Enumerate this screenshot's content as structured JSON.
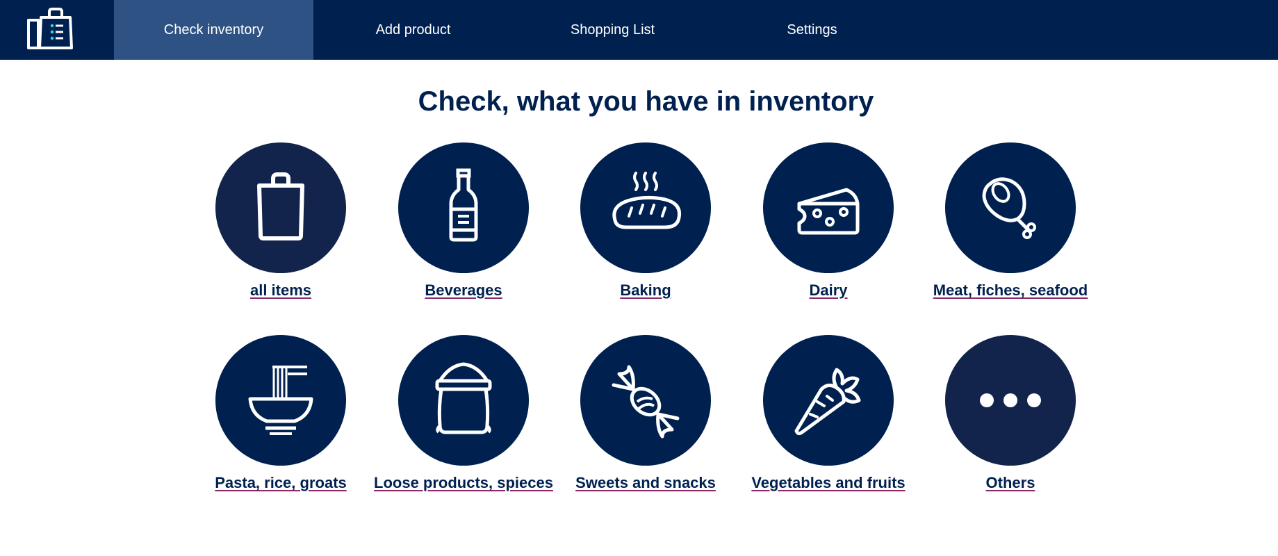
{
  "app": {
    "logo_icon": "shopping-list-bag-icon"
  },
  "nav": {
    "tabs": [
      {
        "label": "Check inventory",
        "active": true
      },
      {
        "label": "Add product",
        "active": false
      },
      {
        "label": "Shopping List",
        "active": false
      },
      {
        "label": "Settings",
        "active": false
      }
    ]
  },
  "main": {
    "title": "Check, what you have in inventory",
    "categories": [
      {
        "label": "all items",
        "icon": "shopping-bag-icon"
      },
      {
        "label": "Beverages",
        "icon": "bottle-icon"
      },
      {
        "label": "Baking",
        "icon": "bread-icon"
      },
      {
        "label": "Dairy",
        "icon": "cheese-icon"
      },
      {
        "label": "Meat, fiches, seafood",
        "icon": "ham-icon"
      },
      {
        "label": "Pasta, rice, groats",
        "icon": "noodle-bowl-icon"
      },
      {
        "label": "Loose products, spieces",
        "icon": "flour-sack-icon"
      },
      {
        "label": "Sweets and snacks",
        "icon": "candy-icon"
      },
      {
        "label": "Vegetables and fruits",
        "icon": "carrot-icon"
      },
      {
        "label": "Others",
        "icon": "more-dots-icon"
      }
    ]
  },
  "colors": {
    "nav_bg": "#00214f",
    "nav_active": "#2e5283",
    "circle": "#00214f",
    "circle_alt": "#13244c",
    "text": "#00214f",
    "underline": "#8b2a6b"
  }
}
